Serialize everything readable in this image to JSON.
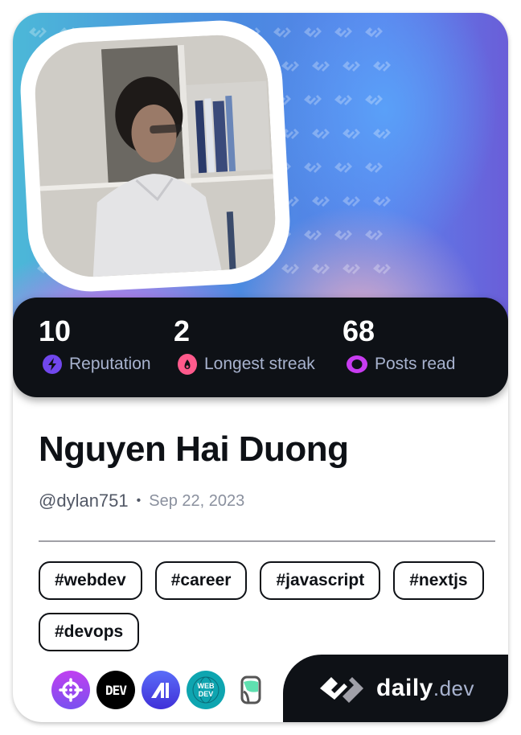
{
  "profile": {
    "name": "Nguyen Hai Duong",
    "handle": "@dylan751",
    "separator": "•",
    "joined": "Sep 22, 2023",
    "avatar_icon": "profile-photo"
  },
  "stats": [
    {
      "value": "10",
      "label": "Reputation",
      "icon": "lightning-icon",
      "color": "#7147ed"
    },
    {
      "value": "2",
      "label": "Longest streak",
      "icon": "flame-icon",
      "color": "#ff5a8c"
    },
    {
      "value": "68",
      "label": "Posts read",
      "icon": "eye-icon",
      "color": "#c83cf0"
    }
  ],
  "tags": [
    "#webdev",
    "#career",
    "#javascript",
    "#nextjs",
    "#devops"
  ],
  "sources": [
    {
      "name": "daily-dev-squad",
      "icon": "crosshair-icon",
      "color": "#a848f0"
    },
    {
      "name": "dev-to",
      "icon": "dev-logo",
      "text": "DEV",
      "color": "#000000"
    },
    {
      "name": "alpha-source",
      "icon": "a-logo",
      "color": "#4e5cf0"
    },
    {
      "name": "web-dev",
      "icon": "web-dev-logo",
      "text": "WEB DEV",
      "color": "#0ea5b0"
    },
    {
      "name": "hashnode-like",
      "icon": "book-logo",
      "color": "#5fe0b0"
    }
  ],
  "brand": {
    "name": "daily",
    "tld": ".dev"
  }
}
